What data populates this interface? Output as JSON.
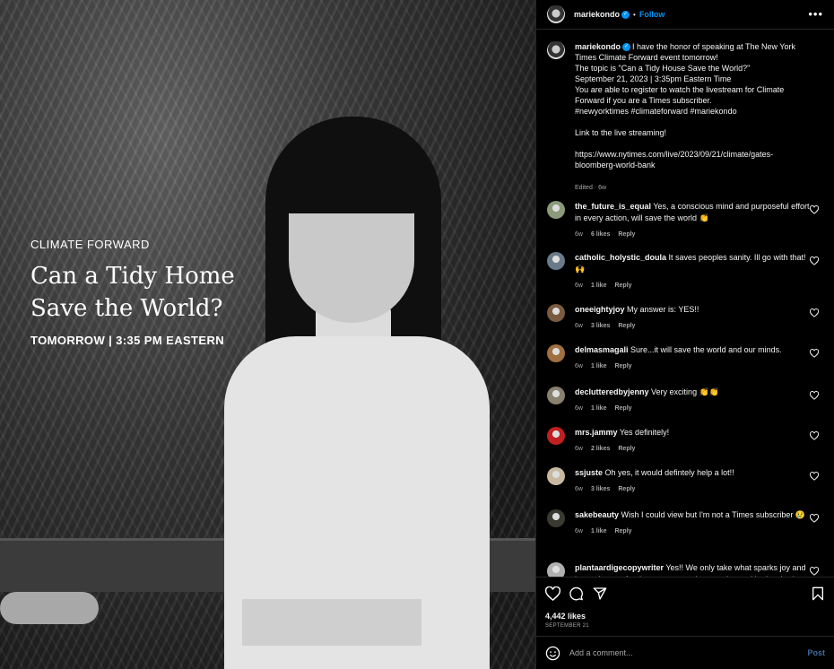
{
  "photo": {
    "kicker": "CLIMATE FORWARD",
    "title_line1": "Can a Tidy Home",
    "title_line2": "Save the World?",
    "time": "TOMORROW | 3:35 PM EASTERN"
  },
  "header": {
    "username": "mariekondo",
    "separator": "•",
    "follow": "Follow",
    "more": "•••"
  },
  "caption": {
    "username": "mariekondo",
    "text": "I have the honor of speaking at The New York Times Climate Forward event tomorrow!\nThe topic is \"Can a Tidy House Save the World?\"\nSeptember 21, 2023 | 3:35pm Eastern Time\nYou are able to register to watch the livestream for Climate Forward if you are a Times subscriber.\n#newyorktimes #climateforward #mariekondo\n\nLink to the live streaming!\n\nhttps://www.nytimes.com/live/2023/09/21/climate/gates-bloomberg-world-bank",
    "edited": "Edited · 6w"
  },
  "comments": [
    {
      "user": "the_future_is_equal",
      "text": "Yes, a conscious mind and purposeful effort in every action, will save the world 👏",
      "age": "6w",
      "likes": "6 likes",
      "reply": "Reply",
      "avatar": "#8a9a7a"
    },
    {
      "user": "catholic_holystic_doula",
      "text": "It saves peoples sanity. Ill go with that! 🙌",
      "age": "6w",
      "likes": "1 like",
      "reply": "Reply",
      "avatar": "#6a7a8a"
    },
    {
      "user": "oneeightyjoy",
      "text": "My answer is: YES!!",
      "age": "6w",
      "likes": "3 likes",
      "reply": "Reply",
      "avatar": "#7a5a40"
    },
    {
      "user": "delmasmagali",
      "text": "Sure...it will save the world and our minds.",
      "age": "6w",
      "likes": "1 like",
      "reply": "Reply",
      "avatar": "#a07040"
    },
    {
      "user": "declutteredbyjenny",
      "text": "Very exciting 👏👏",
      "age": "6w",
      "likes": "1 like",
      "reply": "Reply",
      "avatar": "#8a8070"
    },
    {
      "user": "mrs.jammy",
      "text": "Yes definitely!",
      "age": "6w",
      "likes": "2 likes",
      "reply": "Reply",
      "avatar": "#c02020"
    },
    {
      "user": "ssjuste",
      "text": "Oh yes, it would defintely help a lot!!",
      "age": "6w",
      "likes": "3 likes",
      "reply": "Reply",
      "avatar": "#c8b8a0"
    },
    {
      "user": "sakebeauty",
      "text": "Wish I could view but I'm not a Times subscriber 😢",
      "age": "6w",
      "likes": "1 like",
      "reply": "Reply",
      "avatar": "#3a3a30"
    },
    {
      "user": "plantaardigecopywriter",
      "text": "Yes!! We only take what sparks joy and leave the rest for the next generation to enjoy and be inspired",
      "age": "",
      "likes": "",
      "reply": "",
      "avatar": "#b0b0b0"
    }
  ],
  "footer": {
    "likes": "4,442 likes",
    "date": "SEPTEMBER 21",
    "comment_placeholder": "Add a comment...",
    "post": "Post"
  }
}
